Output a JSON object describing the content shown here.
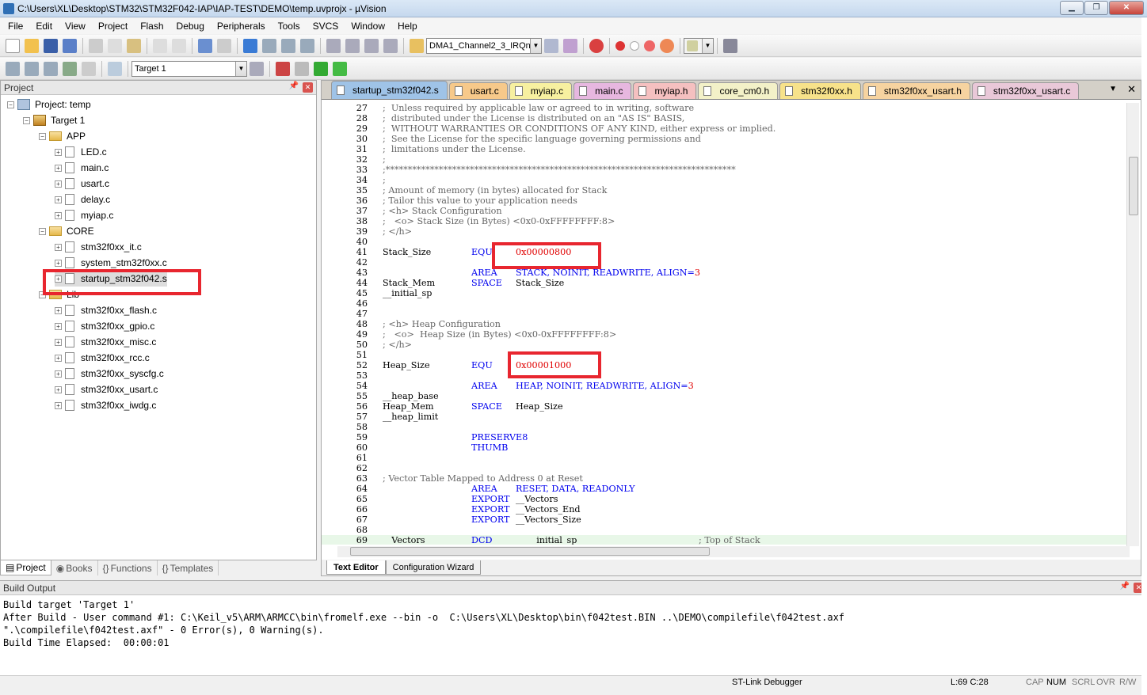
{
  "window": {
    "title": "C:\\Users\\XL\\Desktop\\STM32\\STM32F042-IAP\\IAP-TEST\\DEMO\\temp.uvprojx - µVision"
  },
  "menu": [
    "File",
    "Edit",
    "View",
    "Project",
    "Flash",
    "Debug",
    "Peripherals",
    "Tools",
    "SVCS",
    "Window",
    "Help"
  ],
  "toolbar": {
    "function_combo": "DMA1_Channel2_3_IRQn",
    "target_combo": "Target 1"
  },
  "project_panel": {
    "title": "Project",
    "tree": {
      "project": "Project: temp",
      "target": "Target 1",
      "groups": [
        {
          "name": "APP",
          "files": [
            "LED.c",
            "main.c",
            "usart.c",
            "delay.c",
            "myiap.c"
          ]
        },
        {
          "name": "CORE",
          "files": [
            "stm32f0xx_it.c",
            "system_stm32f0xx.c",
            "startup_stm32f042.s"
          ]
        },
        {
          "name": "Lib",
          "files": [
            "stm32f0xx_flash.c",
            "stm32f0xx_gpio.c",
            "stm32f0xx_misc.c",
            "stm32f0xx_rcc.c",
            "stm32f0xx_syscfg.c",
            "stm32f0xx_usart.c",
            "stm32f0xx_iwdg.c"
          ]
        }
      ]
    },
    "tabs": [
      "Project",
      "Books",
      "Functions",
      "Templates"
    ]
  },
  "editor": {
    "tabs": [
      {
        "label": "startup_stm32f042.s",
        "color": "#9fc3e7"
      },
      {
        "label": "usart.c",
        "color": "#f7c98a"
      },
      {
        "label": "myiap.c",
        "color": "#f7f0a0"
      },
      {
        "label": "main.c",
        "color": "#e7b7e0"
      },
      {
        "label": "myiap.h",
        "color": "#f5c0c0"
      },
      {
        "label": "core_cm0.h",
        "color": "#f3f1c8"
      },
      {
        "label": "stm32f0xx.h",
        "color": "#f7e28a"
      },
      {
        "label": "stm32f0xx_usart.h",
        "color": "#f6d3a0"
      },
      {
        "label": "stm32f0xx_usart.c",
        "color": "#e9c8d8"
      }
    ],
    "lines": [
      {
        "n": "27",
        "t": ";  Unless required by applicable law or agreed to in writing, software",
        "cls": "c"
      },
      {
        "n": "28",
        "t": ";  distributed under the License is distributed on an \"AS IS\" BASIS,",
        "cls": "c"
      },
      {
        "n": "29",
        "t": ";  WITHOUT WARRANTIES OR CONDITIONS OF ANY KIND, either express or implied.",
        "cls": "c"
      },
      {
        "n": "30",
        "t": ";  See the License for the specific language governing permissions and",
        "cls": "c"
      },
      {
        "n": "31",
        "t": ";  limitations under the License.",
        "cls": "c"
      },
      {
        "n": "32",
        "t": ";",
        "cls": "c"
      },
      {
        "n": "33",
        "t": ";*******************************************************************************",
        "cls": "c"
      },
      {
        "n": "34",
        "t": ";",
        "cls": "c"
      },
      {
        "n": "35",
        "t": "; Amount of memory (in bytes) allocated for Stack",
        "cls": "c"
      },
      {
        "n": "36",
        "t": "; Tailor this value to your application needs",
        "cls": "c"
      },
      {
        "n": "37",
        "t": "; <h> Stack Configuration",
        "cls": "c"
      },
      {
        "n": "38",
        "t": ";   <o> Stack Size (in Bytes) <0x0-0xFFFFFFFF:8>",
        "cls": "c"
      },
      {
        "n": "39",
        "t": "; </h>",
        "cls": "c"
      },
      {
        "n": "40",
        "t": "",
        "cls": ""
      },
      {
        "n": "41",
        "a": "Stack_Size",
        "b": "EQU",
        "c": "0x00000800"
      },
      {
        "n": "42",
        "t": "",
        "cls": ""
      },
      {
        "n": "43",
        "a": "",
        "b": "AREA",
        "c2": "STACK, NOINIT, READWRITE, ALIGN=",
        "d": "3"
      },
      {
        "n": "44",
        "a": "Stack_Mem",
        "b": "SPACE",
        "c3": "Stack_Size"
      },
      {
        "n": "45",
        "t": "__initial_sp",
        "cls": ""
      },
      {
        "n": "46",
        "t": "",
        "cls": ""
      },
      {
        "n": "47",
        "t": "",
        "cls": ""
      },
      {
        "n": "48",
        "t": "; <h> Heap Configuration",
        "cls": "c"
      },
      {
        "n": "49",
        "t": ";   <o>  Heap Size (in Bytes) <0x0-0xFFFFFFFF:8>",
        "cls": "c"
      },
      {
        "n": "50",
        "t": "; </h>",
        "cls": "c"
      },
      {
        "n": "51",
        "t": "",
        "cls": ""
      },
      {
        "n": "52",
        "a": "Heap_Size",
        "b": "EQU",
        "c": "0x00001000"
      },
      {
        "n": "53",
        "t": "",
        "cls": ""
      },
      {
        "n": "54",
        "a": "",
        "b": "AREA",
        "c2": "HEAP, NOINIT, READWRITE, ALIGN=",
        "d": "3"
      },
      {
        "n": "55",
        "t": "__heap_base",
        "cls": ""
      },
      {
        "n": "56",
        "a": "Heap_Mem",
        "b": "SPACE",
        "c3": "Heap_Size"
      },
      {
        "n": "57",
        "t": "__heap_limit",
        "cls": ""
      },
      {
        "n": "58",
        "t": "",
        "cls": ""
      },
      {
        "n": "59",
        "a": "",
        "b": "PRESERVE8"
      },
      {
        "n": "60",
        "a": "",
        "b": "THUMB"
      },
      {
        "n": "61",
        "t": "",
        "cls": ""
      },
      {
        "n": "62",
        "t": "",
        "cls": ""
      },
      {
        "n": "63",
        "t": "; Vector Table Mapped to Address 0 at Reset",
        "cls": "c"
      },
      {
        "n": "64",
        "a": "",
        "b": "AREA",
        "c3": "RESET, DATA, READONLY",
        "kw": true
      },
      {
        "n": "65",
        "a": "",
        "b": "EXPORT",
        "c3": "__Vectors"
      },
      {
        "n": "66",
        "a": "",
        "b": "EXPORT",
        "c3": "__Vectors_End"
      },
      {
        "n": "67",
        "a": "",
        "b": "EXPORT",
        "c3": "__Vectors_Size"
      },
      {
        "n": "68",
        "t": "",
        "cls": ""
      },
      {
        "n": "69",
        "a": "__Vectors",
        "b": "DCD",
        "c3": "__initial_sp",
        "e": "; Top of Stack",
        "hl": true
      }
    ],
    "bottom_tabs": [
      "Text Editor",
      "Configuration Wizard"
    ]
  },
  "build_output": {
    "title": "Build Output",
    "lines": [
      "Build target 'Target 1'",
      "After Build - User command #1: C:\\Keil_v5\\ARM\\ARMCC\\bin\\fromelf.exe --bin -o  C:\\Users\\XL\\Desktop\\bin\\f042test.BIN ..\\DEMO\\compilefile\\f042test.axf",
      "\".\\compilefile\\f042test.axf\" - 0 Error(s), 0 Warning(s).",
      "Build Time Elapsed:  00:00:01"
    ]
  },
  "status": {
    "debugger": "ST-Link Debugger",
    "position": "L:69 C:28",
    "caps": "CAP",
    "num": "NUM",
    "scrl": "SCRL",
    "ovr": "OVR",
    "rw": "R/W"
  }
}
